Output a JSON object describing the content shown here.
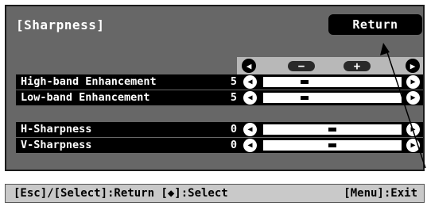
{
  "menu": {
    "title": "[Sharpness]",
    "return_label": "Return"
  },
  "header_controls": {
    "left_arrow": "◀",
    "minus": "−",
    "plus": "+",
    "right_arrow": "▶"
  },
  "settings": [
    {
      "label": "High-band Enhancement",
      "value": "5",
      "level": 0.3
    },
    {
      "label": "Low-band Enhancement",
      "value": "5",
      "level": 0.3
    },
    {
      "label": "H-Sharpness",
      "value": "0",
      "level": 0.5
    },
    {
      "label": "V-Sharpness",
      "value": "0",
      "level": 0.5
    }
  ],
  "arrows": {
    "left": "◀",
    "right": "▶"
  },
  "status_bar": {
    "left": "[Esc]/[Select]:Return [◆]:Select",
    "right": "[Menu]:Exit"
  },
  "colors": {
    "menu_bg": "#676767",
    "row_bg": "#000000",
    "status_bg": "#c9c9c9"
  }
}
